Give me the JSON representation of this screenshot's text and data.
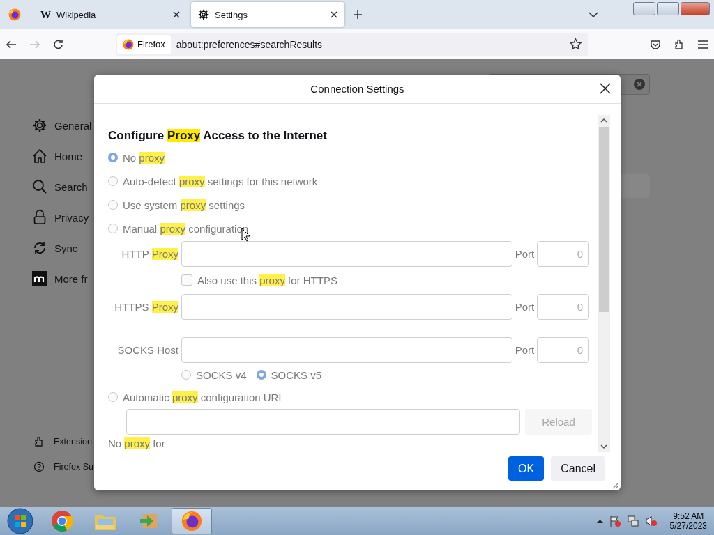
{
  "browser": {
    "tabs": [
      {
        "kind": "wiki",
        "icon_text": "W",
        "label": "Wikipedia",
        "selected": false
      },
      {
        "kind": "settings",
        "label": "Settings",
        "selected": true
      }
    ],
    "identity": "Firefox",
    "url": "about:preferences#searchResults"
  },
  "sidebar": {
    "items": [
      {
        "kind": "gear",
        "label": "General"
      },
      {
        "kind": "home",
        "label": "Home"
      },
      {
        "kind": "search",
        "label": "Search"
      },
      {
        "kind": "lock",
        "label": "Privacy"
      },
      {
        "kind": "sync",
        "label": "Sync"
      },
      {
        "kind": "mozilla",
        "label": "More fr"
      }
    ],
    "footer_items": [
      {
        "kind": "puzzle",
        "label": "Extension"
      },
      {
        "kind": "help",
        "label": "Firefox Su"
      }
    ]
  },
  "dialog": {
    "title": "Connection Settings",
    "heading": [
      {
        "text": "Configure ",
        "highlight": false
      },
      {
        "text": "Proxy",
        "highlight": true
      },
      {
        "text": " Access to the Internet",
        "highlight": false
      }
    ],
    "modes": [
      {
        "selected": true,
        "parts": [
          {
            "text": "No ",
            "highlight": false
          },
          {
            "text": "proxy",
            "highlight": true
          }
        ]
      },
      {
        "selected": false,
        "parts": [
          {
            "text": "Auto-detect ",
            "highlight": false
          },
          {
            "text": "proxy",
            "highlight": true
          },
          {
            "text": " settings for this network",
            "highlight": false
          }
        ]
      },
      {
        "selected": false,
        "parts": [
          {
            "text": "Use system ",
            "highlight": false
          },
          {
            "text": "proxy",
            "highlight": true
          },
          {
            "text": " settings",
            "highlight": false
          }
        ]
      },
      {
        "selected": false,
        "parts": [
          {
            "text": "Manual ",
            "highlight": false
          },
          {
            "text": "proxy",
            "highlight": true
          },
          {
            "text": " configuration",
            "highlight": false
          }
        ]
      },
      {
        "selected": false,
        "parts": [
          {
            "text": "Automatic ",
            "highlight": false
          },
          {
            "text": "proxy",
            "highlight": true
          },
          {
            "text": " configuration URL",
            "highlight": false
          }
        ]
      }
    ],
    "manual_rows": [
      {
        "label": [
          {
            "text": "HTTP ",
            "highlight": false
          },
          {
            "text": "Proxy",
            "highlight": true
          }
        ],
        "port_label": "Port",
        "port_placeholder": "0"
      },
      {
        "label": [
          {
            "text": "HTTPS ",
            "highlight": false
          },
          {
            "text": "Proxy",
            "highlight": true
          }
        ],
        "port_label": "Port",
        "port_placeholder": "0"
      },
      {
        "label": [
          {
            "text": "SOCKS Host",
            "highlight": false
          }
        ],
        "port_label": "Port",
        "port_placeholder": "0"
      }
    ],
    "also_https": {
      "checked": false,
      "parts": [
        {
          "text": "Also use this ",
          "highlight": false
        },
        {
          "text": "proxy",
          "highlight": true
        },
        {
          "text": " for HTTPS",
          "highlight": false
        }
      ]
    },
    "socks_versions": [
      {
        "label": "SOCKS v4",
        "selected": false
      },
      {
        "label": "SOCKS v5",
        "selected": true
      }
    ],
    "reload_button": {
      "label": "Reload",
      "disabled": true
    },
    "no_proxy_label": [
      {
        "text": "No ",
        "highlight": false
      },
      {
        "text": "proxy",
        "highlight": true
      },
      {
        "text": " for",
        "highlight": false
      }
    ],
    "buttons": [
      {
        "kind": "primary",
        "label": "OK"
      },
      {
        "kind": "secondary",
        "label": "Cancel"
      }
    ]
  },
  "taskbar": {
    "apps": [
      {
        "kind": "chrome",
        "selected": false
      },
      {
        "kind": "explorer",
        "selected": false
      },
      {
        "kind": "arrow",
        "selected": false
      },
      {
        "kind": "firefox",
        "selected": true
      }
    ],
    "time": "9:52 AM",
    "date": "5/27/2023"
  }
}
